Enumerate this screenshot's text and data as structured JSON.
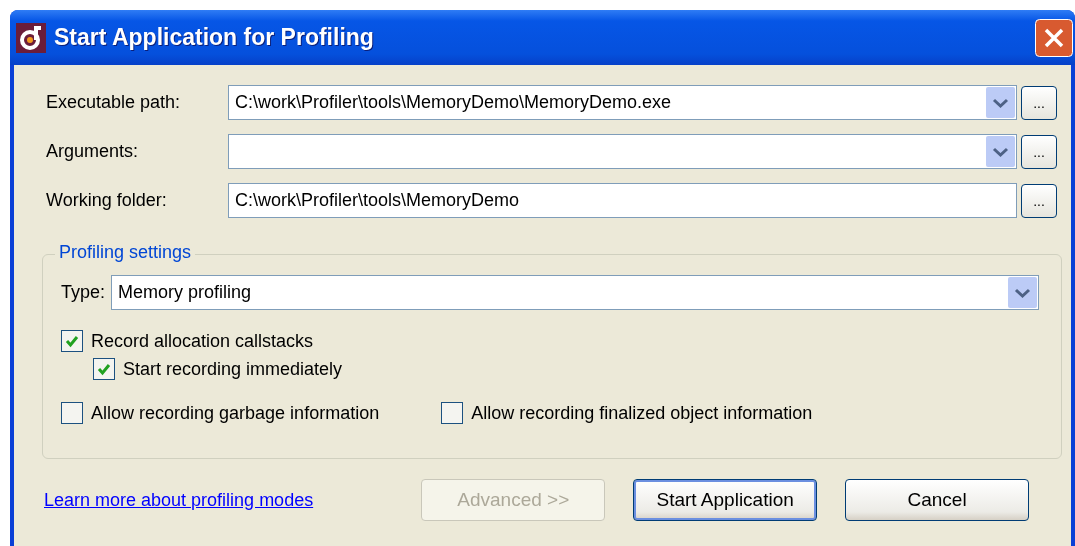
{
  "window": {
    "title": "Start Application for Profiling"
  },
  "fields": [
    {
      "label": "Executable path:",
      "value": "C:\\work\\Profiler\\tools\\MemoryDemo\\MemoryDemo.exe",
      "kind": "combo",
      "browse": "..."
    },
    {
      "label": "Arguments:",
      "kind": "combo",
      "browse": "..."
    },
    {
      "label": "Working folder:",
      "value": "C:\\work\\Profiler\\tools\\MemoryDemo",
      "kind": "text",
      "browse": "..."
    }
  ],
  "profiling_settings": {
    "legend": "Profiling settings",
    "type_label": "Type:",
    "type_value": "Memory profiling",
    "options": [
      {
        "label": "Record allocation callstacks",
        "checked": true,
        "children": [
          {
            "label": "Start recording immediately",
            "checked": true
          }
        ]
      }
    ],
    "extra_options": [
      {
        "label": "Allow recording garbage information",
        "checked": false
      },
      {
        "label": "Allow recording finalized object information",
        "checked": false
      }
    ]
  },
  "link": "Learn more about profiling modes",
  "buttons": [
    {
      "label": "Advanced >>",
      "disabled": true,
      "default": false
    },
    {
      "label": "Start Application",
      "disabled": false,
      "default": true
    },
    {
      "label": "Cancel",
      "disabled": false,
      "default": false
    }
  ]
}
